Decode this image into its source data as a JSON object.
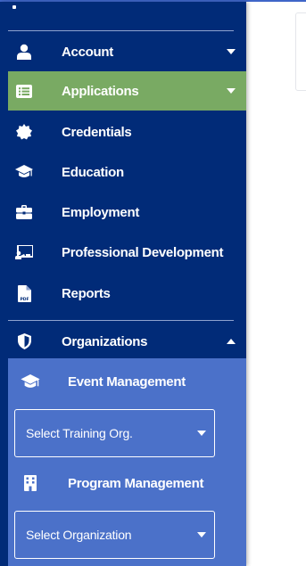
{
  "sidebar": {
    "items": [
      {
        "label": "Account",
        "icon": "user-icon",
        "caret": "down"
      },
      {
        "label": "Applications",
        "icon": "list-icon",
        "caret": "down",
        "active": true
      },
      {
        "label": "Credentials",
        "icon": "badge-icon"
      },
      {
        "label": "Education",
        "icon": "graduation-cap-icon"
      },
      {
        "label": "Employment",
        "icon": "briefcase-icon"
      },
      {
        "label": "Professional Development",
        "icon": "presentation-icon"
      },
      {
        "label": "Reports",
        "icon": "pdf-file-icon"
      },
      {
        "label": "Organizations",
        "icon": "shield-icon",
        "caret": "up"
      }
    ],
    "organizations": {
      "event_management": {
        "label": "Event Management",
        "icon": "graduation-cap-icon"
      },
      "training_select": {
        "value": "Select Training Org."
      },
      "program_management": {
        "label": "Program Management",
        "icon": "building-icon"
      },
      "organization_select": {
        "value": "Select Organization"
      }
    }
  },
  "colors": {
    "sidebar_bg": "#012b78",
    "active_bg": "#79aa63",
    "subpanel_bg": "#4b71c9",
    "text": "#ffffff"
  }
}
